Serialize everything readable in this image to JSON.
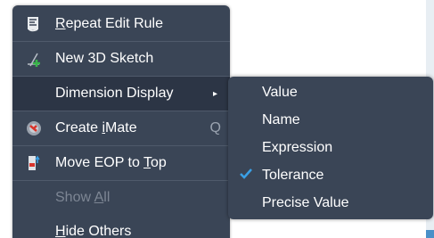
{
  "context_menu": {
    "items": [
      {
        "label_pre": "",
        "label_ul": "R",
        "label_post": "epeat Edit Rule",
        "icon": "repeat-rule-icon"
      },
      {
        "label_pre": "New 3D Sketch",
        "label_ul": "",
        "label_post": "",
        "icon": "sketch-3d-icon"
      },
      {
        "label_pre": "Dimension Display",
        "label_ul": "",
        "label_post": "",
        "icon": "",
        "submenu_arrow": "▸"
      },
      {
        "label_pre": "Create ",
        "label_ul": "i",
        "label_post": "Mate",
        "icon": "imate-icon",
        "shortcut": "Q"
      },
      {
        "label_pre": "Move EOP to ",
        "label_ul": "T",
        "label_post": "op",
        "icon": "move-eop-icon"
      },
      {
        "label_pre": "Show ",
        "label_ul": "A",
        "label_post": "ll",
        "icon": "",
        "disabled": true
      },
      {
        "label_pre": "",
        "label_ul": "H",
        "label_post": "ide Others",
        "icon": ""
      }
    ]
  },
  "dimension_display_submenu": {
    "items": [
      {
        "label": "Value",
        "checked": false
      },
      {
        "label": "Name",
        "checked": false
      },
      {
        "label": "Expression",
        "checked": false
      },
      {
        "label": "Tolerance",
        "checked": true
      },
      {
        "label": "Precise Value",
        "checked": false
      }
    ]
  },
  "colors": {
    "menu_bg": "#3a4556",
    "highlight_bg": "#2c3545",
    "check_color": "#3aa0e6",
    "disabled_text": "#7d8694"
  }
}
